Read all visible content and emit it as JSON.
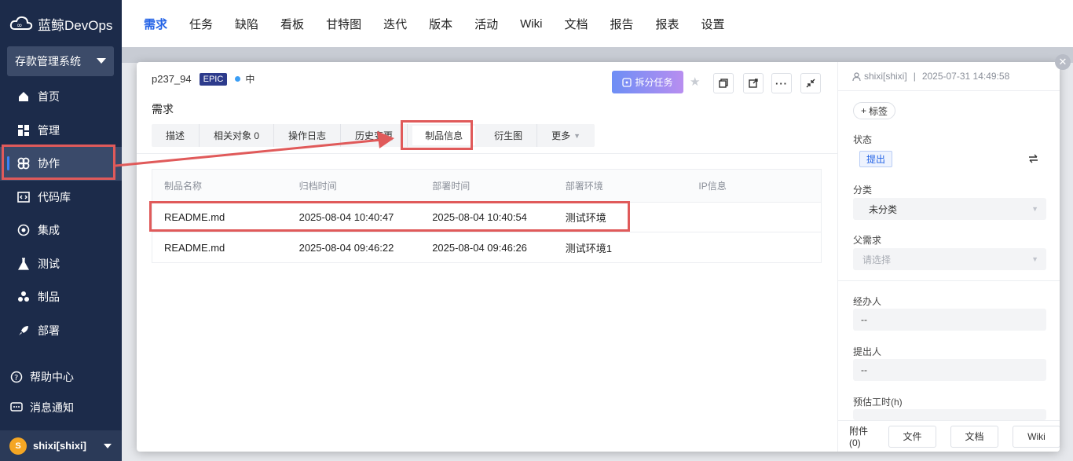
{
  "app": {
    "brand": "蓝鲸DevOps",
    "project": "存款管理系统"
  },
  "sidebar": {
    "items": [
      {
        "label": "首页",
        "icon": "home-icon"
      },
      {
        "label": "管理",
        "icon": "grid-icon"
      },
      {
        "label": "协作",
        "icon": "collab-icon",
        "active": true
      },
      {
        "label": "代码库",
        "icon": "code-icon"
      },
      {
        "label": "集成",
        "icon": "integration-icon"
      },
      {
        "label": "测试",
        "icon": "flask-icon"
      },
      {
        "label": "制品",
        "icon": "artifact-icon"
      },
      {
        "label": "部署",
        "icon": "rocket-icon"
      }
    ],
    "help": "帮助中心",
    "notify": "消息通知",
    "user": {
      "initial": "S",
      "name": "shixi[shixi]"
    }
  },
  "topbar": {
    "tabs": [
      "需求",
      "任务",
      "缺陷",
      "看板",
      "甘特图",
      "迭代",
      "版本",
      "活动",
      "Wiki",
      "文档",
      "报告",
      "报表",
      "设置"
    ],
    "active": "需求"
  },
  "modal": {
    "issue_id": "p237_94",
    "badge": "EPIC",
    "priority": "中",
    "split_label": "拆分任务",
    "title": "需求",
    "tabs": [
      "描述",
      "相关对象 0",
      "操作日志",
      "历史变更",
      "制品信息",
      "衍生图",
      "更多"
    ],
    "active_tab": "制品信息",
    "table": {
      "headers": [
        "制品名称",
        "归档时间",
        "部署时间",
        "部署环境",
        "IP信息"
      ],
      "rows": [
        [
          "README.md",
          "2025-08-04 10:40:47",
          "2025-08-04 10:40:54",
          "测试环境",
          ""
        ],
        [
          "README.md",
          "2025-08-04 09:46:22",
          "2025-08-04 09:46:26",
          "测试环境1",
          ""
        ]
      ]
    }
  },
  "right_pane": {
    "creator": "shixi[shixi]",
    "sep": "|",
    "created_at": "2025-07-31 14:49:58",
    "add_tag": "标签",
    "status_label": "状态",
    "status_value": "提出",
    "category_label": "分类",
    "category_value": "未分类",
    "parent_label": "父需求",
    "parent_placeholder": "请选择",
    "assignee_label": "经办人",
    "assignee_value": "--",
    "reporter_label": "提出人",
    "reporter_value": "--",
    "estimate_label": "预估工时(h)",
    "attachments": "附件 (0)",
    "btn_file": "文件",
    "btn_doc": "文档",
    "btn_wiki": "Wiki"
  },
  "colors": {
    "accent": "#2463e6",
    "highlight": "#e05a5a",
    "sidebar": "#1c2b4a"
  }
}
